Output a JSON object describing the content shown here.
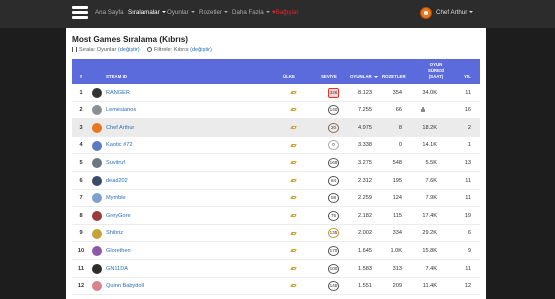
{
  "nav": {
    "home": "Ana Sayfa",
    "rankings": "Sıralamalar",
    "games": "Oyunlar",
    "achievements": "Rozetler",
    "more": "Daha Fazla",
    "donate_heart": "♥",
    "donate": "Bağışlar",
    "user": "Chef Arthur"
  },
  "page": {
    "title": "Most Games Sıralama (Kıbrıs)",
    "sort_label": "Sırala: Oyunlar",
    "sort_change": "(değiştir)",
    "filter_label": "Filtrele: Kıbrıs",
    "filter_change": "(değiştir)"
  },
  "table": {
    "headers": {
      "rank": "#",
      "steam_id": "STEAM ID",
      "country": "ÜLKE",
      "level": "SEVİYE",
      "games": "OYUNLAR",
      "badges": "ROZETLER",
      "playtime_1": "OYUN",
      "playtime_2": "SÜRESİ",
      "playtime_3": "(SAAT)",
      "years": "YIL"
    },
    "rows": [
      {
        "rank": "1",
        "name": "RANGER",
        "level": "326",
        "games": "8.123",
        "badges": "354",
        "hours": "34.0K",
        "years": "11",
        "avatar": "#333333",
        "highlight": false,
        "level_color": "#e0352b",
        "locked": false
      },
      {
        "rank": "2",
        "name": "Lemesianos",
        "level": "140",
        "games": "7.255",
        "badges": "66",
        "hours": "",
        "years": "16",
        "avatar": "#8a8f96",
        "highlight": false,
        "level_color": "#555555",
        "locked": true
      },
      {
        "rank": "3",
        "name": "Chef Arthur",
        "level": "20",
        "games": "4.975",
        "badges": "8",
        "hours": "18.2K",
        "years": "2",
        "avatar": "#e8771d",
        "highlight": true,
        "level_color": "#8e6a4a",
        "locked": false
      },
      {
        "rank": "4",
        "name": "Kaotic #72",
        "level": "0",
        "games": "3.338",
        "badges": "0",
        "hours": "14.1K",
        "years": "1",
        "avatar": "#5a7bc0",
        "highlight": false,
        "level_color": "#aaaaaa",
        "locked": false
      },
      {
        "rank": "5",
        "name": "Suvitruf",
        "level": "169",
        "games": "3.275",
        "badges": "548",
        "hours": "5.5K",
        "years": "13",
        "avatar": "#6b7684",
        "highlight": false,
        "level_color": "#555555",
        "locked": false
      },
      {
        "rank": "6",
        "name": "dead202",
        "level": "84",
        "games": "2.312",
        "badges": "195",
        "hours": "7.6K",
        "years": "11",
        "avatar": "#3b4a6b",
        "highlight": false,
        "level_color": "#555555",
        "locked": false
      },
      {
        "rank": "7",
        "name": "Mymble",
        "level": "58",
        "games": "2.259",
        "badges": "124",
        "hours": "7.9K",
        "years": "11",
        "avatar": "#7ca0cf",
        "highlight": false,
        "level_color": "#555555",
        "locked": false
      },
      {
        "rank": "8",
        "name": "GreyGore",
        "level": "75",
        "games": "2.182",
        "badges": "115",
        "hours": "17.4K",
        "years": "19",
        "avatar": "#9c3b3b",
        "highlight": false,
        "level_color": "#555555",
        "locked": false
      },
      {
        "rank": "9",
        "name": "Shibriz",
        "level": "135",
        "games": "2.002",
        "badges": "334",
        "hours": "29.2K",
        "years": "6",
        "avatar": "#c7a23a",
        "highlight": false,
        "level_color": "#b89a2a",
        "locked": false
      },
      {
        "rank": "10",
        "name": "Glorethen",
        "level": "170",
        "games": "1.645",
        "badges": "1.0K",
        "hours": "15.8K",
        "years": "9",
        "avatar": "#8e5aa8",
        "highlight": false,
        "level_color": "#555555",
        "locked": false
      },
      {
        "rank": "11",
        "name": "GN11DA",
        "level": "100",
        "games": "1.583",
        "badges": "313",
        "hours": "7.4K",
        "years": "11",
        "avatar": "#2e2e2e",
        "highlight": false,
        "level_color": "#555555",
        "locked": false
      },
      {
        "rank": "12",
        "name": "Quinn Babydoll",
        "level": "145",
        "games": "1.551",
        "badges": "209",
        "hours": "11.4K",
        "years": "12",
        "avatar": "#d9828e",
        "highlight": false,
        "level_color": "#555555",
        "locked": false
      }
    ]
  },
  "colors": {
    "table_header": "#5c6bdc",
    "link": "#2a6fb5",
    "navbar": "#2c2c2c"
  }
}
